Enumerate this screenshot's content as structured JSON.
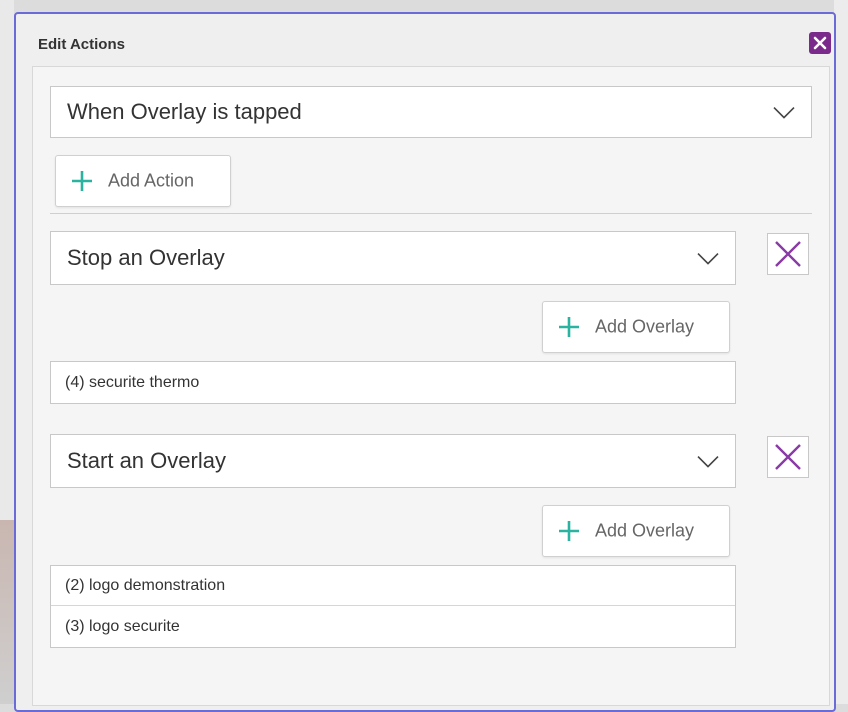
{
  "dialog": {
    "title": "Edit Actions",
    "close_color": "#7a2a8a"
  },
  "trigger": {
    "selected": "When Overlay is tapped"
  },
  "add_action_label": "Add Action",
  "actions": [
    {
      "type": "Stop an Overlay",
      "add_overlay_label": "Add Overlay",
      "overlays": [
        "(4) securite thermo"
      ]
    },
    {
      "type": "Start an Overlay",
      "add_overlay_label": "Add Overlay",
      "overlays": [
        "(2) logo demonstration",
        "(3) logo securite"
      ]
    }
  ],
  "colors": {
    "accent_plus": "#2ab3a0",
    "remove_x": "#8a3aa6",
    "dialog_border": "#6b6bd8"
  },
  "icons": {
    "close": "close-icon",
    "chevron": "chevron-down-icon",
    "plus": "plus-icon",
    "remove": "remove-icon"
  }
}
